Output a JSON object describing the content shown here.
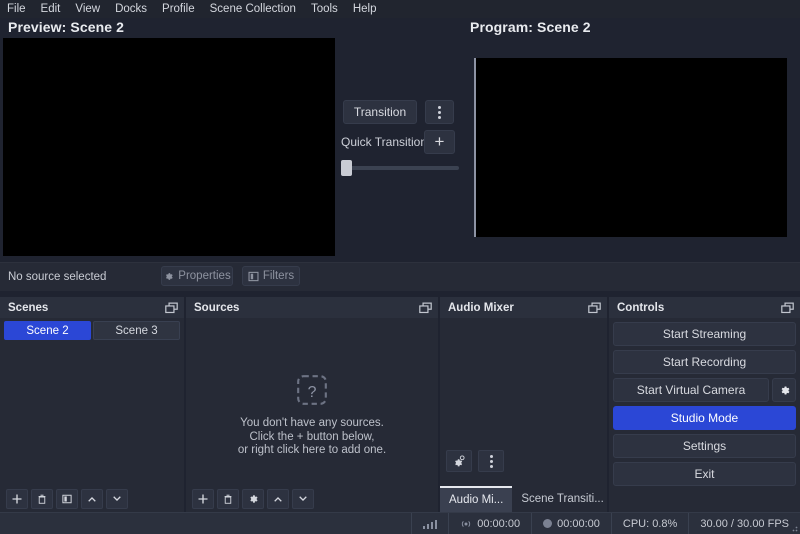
{
  "menubar": {
    "items": [
      {
        "label": "File"
      },
      {
        "label": "Edit"
      },
      {
        "label": "View"
      },
      {
        "label": "Docks"
      },
      {
        "label": "Profile"
      },
      {
        "label": "Scene Collection"
      },
      {
        "label": "Tools"
      },
      {
        "label": "Help"
      }
    ]
  },
  "preview": {
    "title": "Preview: Scene 2"
  },
  "program": {
    "title": "Program: Scene 2"
  },
  "transition": {
    "button_label": "Transition",
    "menu_icon": "vertical-dots-icon",
    "quick_transitions_label": "Quick Transitions",
    "add_label": "+",
    "tbar_value": 0
  },
  "source_bar": {
    "status": "No source selected",
    "properties_label": "Properties",
    "properties_icon": "gear-icon",
    "filters_label": "Filters",
    "filters_icon": "filters-icon"
  },
  "docks": {
    "scenes": {
      "title": "Scenes",
      "float_icon": "float-window-icon",
      "items": [
        {
          "label": "Scene 2",
          "selected": true
        },
        {
          "label": "Scene 3",
          "selected": false
        }
      ],
      "toolbar": [
        {
          "name": "add-scene-button",
          "icon": "plus-icon"
        },
        {
          "name": "remove-scene-button",
          "icon": "trash-icon"
        },
        {
          "name": "scene-filters-button",
          "icon": "filters-icon"
        },
        {
          "name": "move-scene-up-button",
          "icon": "chevron-up-icon"
        },
        {
          "name": "move-scene-down-button",
          "icon": "chevron-down-icon"
        }
      ]
    },
    "sources": {
      "title": "Sources",
      "float_icon": "float-window-icon",
      "empty_icon": "question-placeholder-icon",
      "empty_lines": [
        "You don't have any sources.",
        "Click the + button below,",
        "or right click here to add one."
      ],
      "toolbar": [
        {
          "name": "add-source-button",
          "icon": "plus-icon"
        },
        {
          "name": "remove-source-button",
          "icon": "trash-icon"
        },
        {
          "name": "source-properties-button",
          "icon": "gear-icon"
        },
        {
          "name": "move-source-up-button",
          "icon": "chevron-up-icon"
        },
        {
          "name": "move-source-down-button",
          "icon": "chevron-down-icon"
        }
      ]
    },
    "mixer": {
      "title": "Audio Mixer",
      "float_icon": "float-window-icon",
      "advanced_icon": "audio-gears-icon",
      "menu_icon": "vertical-dots-icon",
      "tabs": [
        {
          "label": "Audio Mi...",
          "active": true
        },
        {
          "label": "Scene Transiti...",
          "active": false
        }
      ]
    },
    "controls": {
      "title": "Controls",
      "float_icon": "float-window-icon",
      "buttons": [
        {
          "label": "Start Streaming",
          "primary": false
        },
        {
          "label": "Start Recording",
          "primary": false
        },
        {
          "label": "Start Virtual Camera",
          "primary": false
        },
        {
          "label": "Studio Mode",
          "primary": true
        },
        {
          "label": "Settings",
          "primary": false
        },
        {
          "label": "Exit",
          "primary": false
        }
      ],
      "virtual_camera_settings_icon": "gear-icon"
    }
  },
  "statusbar": {
    "signal_icon": "signal-bars-icon",
    "stream_icon": "broadcast-icon",
    "stream_time": "00:00:00",
    "record_icon": "record-dot-icon",
    "record_time": "00:00:00",
    "cpu": "CPU: 0.8%",
    "fps": "30.00 / 30.00 FPS",
    "resize_grip_icon": "resize-grip-icon"
  },
  "colors": {
    "accent": "#2b47d6",
    "panel": "#262a36",
    "header": "#2b303d",
    "window": "#1f2330"
  }
}
